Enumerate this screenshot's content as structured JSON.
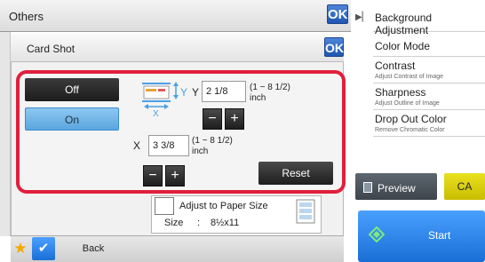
{
  "others": {
    "title": "Others",
    "ok_label": "OK"
  },
  "right_menu": {
    "background_adjustment": "Background Adjustment",
    "color_mode": "Color Mode",
    "contrast": {
      "title": "Contrast",
      "subtitle": "Adjust Contrast of Image"
    },
    "sharpness": {
      "title": "Sharpness",
      "subtitle": "Adjust Outline of Image"
    },
    "drop_out_color": {
      "title": "Drop Out Color",
      "subtitle": "Remove Chromatic Color"
    }
  },
  "actions": {
    "preview_label": "Preview",
    "ca_label": "CA",
    "start_label": "Start"
  },
  "card_shot": {
    "title": "Card Shot",
    "ok_label": "OK",
    "off_label": "Off",
    "on_label": "On",
    "on_selected": true,
    "y_axis_label": "Y",
    "y_value": "2 1/8",
    "y_range": "(1 ~ 8 1/2)",
    "y_unit": "inch",
    "x_axis_label": "X",
    "x_value": "3 3/8",
    "x_range": "(1 ~ 8 1/2)",
    "x_unit": "inch",
    "minus_label": "−",
    "plus_label": "+",
    "reset_label": "Reset",
    "adjust_paper_label": "Adjust to Paper Size",
    "size_label": "Size",
    "size_colon": ":",
    "size_value": "8½x11"
  },
  "bottom_bar": {
    "back_label": "Back"
  },
  "colors": {
    "highlight": "#e01f3c",
    "ok_blue": "#2a63c2",
    "on_button": "#6fb3e6",
    "start_blue": "#2a86f0",
    "ca_yellow": "#dcd10a",
    "favorite_star": "#f2a900"
  },
  "icons": [
    "ok-icon",
    "card-scan-icon",
    "paper-size-icon",
    "preview-document-icon",
    "start-diamond-icon",
    "star-icon",
    "checkmark-icon",
    "menu-arrow-icon"
  ]
}
